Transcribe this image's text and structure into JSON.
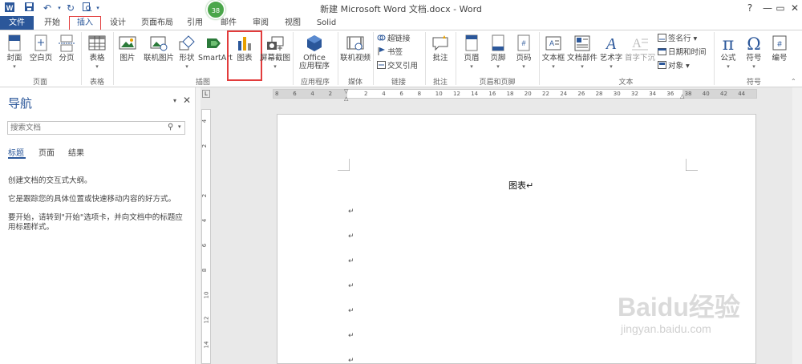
{
  "window": {
    "title": "新建 Microsoft Word 文档.docx - Word"
  },
  "quick_access": {
    "save_icon": "save-icon",
    "undo_icon": "undo-icon",
    "redo_icon": "redo-icon",
    "preview_icon": "print-preview-icon"
  },
  "window_controls": {
    "help": "?",
    "minimize": "—",
    "restore": "▭",
    "close": "✕"
  },
  "badge": "38",
  "tabs": [
    {
      "label": "文件"
    },
    {
      "label": "开始"
    },
    {
      "label": "插入"
    },
    {
      "label": "设计"
    },
    {
      "label": "页面布局"
    },
    {
      "label": "引用"
    },
    {
      "label": "邮件"
    },
    {
      "label": "审阅"
    },
    {
      "label": "视图"
    },
    {
      "label": "Solid"
    }
  ],
  "active_tab": "插入",
  "ribbon": {
    "pages": {
      "group": "页面",
      "cover": "封面",
      "blank": "空白页",
      "break": "分页"
    },
    "tables": {
      "group": "表格",
      "table": "表格"
    },
    "illustrations": {
      "group": "插图",
      "picture": "图片",
      "online_picture": "联机图片",
      "shapes": "形状",
      "smartart": "SmartArt",
      "chart": "图表",
      "screenshot": "屏幕截图"
    },
    "apps": {
      "group": "应用程序",
      "office_line1": "Office",
      "office_line2": "应用程序"
    },
    "media": {
      "group": "媒体",
      "online_video": "联机视频"
    },
    "links": {
      "group": "链接",
      "hyperlink": "超链接",
      "bookmark": "书签",
      "crossref": "交叉引用"
    },
    "comments": {
      "group": "批注",
      "comment": "批注"
    },
    "header_footer": {
      "group": "页眉和页脚",
      "header": "页眉",
      "footer": "页脚",
      "page_number": "页码"
    },
    "text": {
      "group": "文本",
      "textbox": "文本框",
      "quickparts": "文档部件",
      "wordart": "艺术字",
      "dropcap": "首字下沉",
      "signature": "签名行",
      "datetime": "日期和时间",
      "object": "对象"
    },
    "symbols": {
      "group": "符号",
      "equation": "公式",
      "symbol": "符号",
      "number": "编号"
    }
  },
  "nav": {
    "title": "导航",
    "search_placeholder": "搜索文档",
    "tabs": [
      "标题",
      "页面",
      "结果"
    ],
    "text1": "创建文档的交互式大纲。",
    "text2": "它是跟踪您的具体位置或快速移动内容的好方式。",
    "text3": "要开始，请转到\"开始\"选项卡，并向文档中的标题应用标题样式。"
  },
  "ruler": {
    "h_ticks": [
      "8",
      "6",
      "4",
      "2",
      "",
      "2",
      "4",
      "6",
      "8",
      "10",
      "12",
      "14",
      "16",
      "18",
      "20",
      "22",
      "24",
      "26",
      "28",
      "30",
      "32",
      "34",
      "36",
      "38",
      "40",
      "42",
      "44"
    ],
    "v_ticks": [
      "4",
      "2",
      "",
      "2",
      "4",
      "6",
      "8",
      "10",
      "12",
      "14"
    ],
    "corner": "L"
  },
  "document": {
    "title": "图表↵",
    "para_mark": "↵"
  },
  "watermark": {
    "brand": "Baidu经验",
    "url": "jingyan.baidu.com"
  },
  "colors": {
    "accent": "#2b579a",
    "highlight": "#e23c3c",
    "badge": "#4aa64a"
  }
}
